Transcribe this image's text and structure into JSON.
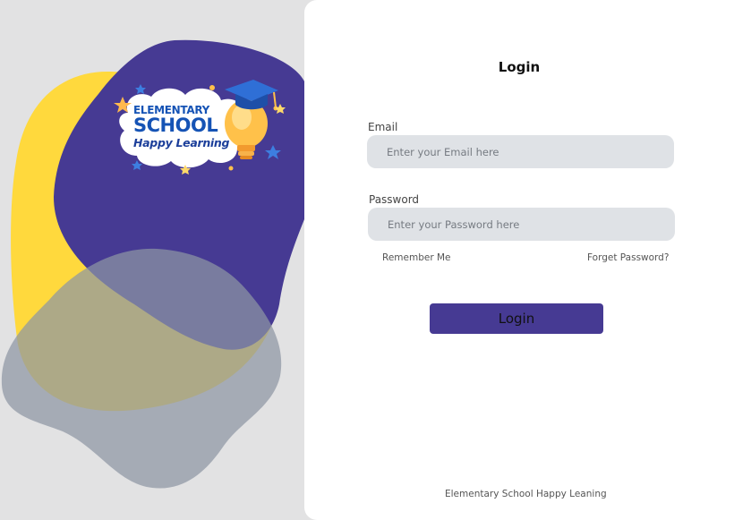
{
  "logo": {
    "line1": "ELEMENTARY",
    "line2": "SCHOOL",
    "line3": "Happy Learning"
  },
  "login": {
    "title": "Login",
    "email_label": "Email",
    "email_placeholder": "Enter your Email here",
    "password_label": "Password",
    "password_placeholder": "Enter your Password here",
    "remember_label": "Remember Me",
    "forgot_label": "Forget Password?",
    "button_label": "Login"
  },
  "footer": {
    "text": "Elementary School Happy Leaning"
  },
  "colors": {
    "background": "#e2e2e3",
    "card": "#ffffff",
    "accent": "#463a93",
    "yellow_blob": "#ffd93d",
    "purple_blob": "#463a93",
    "grey_blob": "#8d95a3",
    "input_bg": "#dfe2e6"
  },
  "icons": [
    "graduation-cap-icon",
    "lightbulb-icon",
    "star-icon"
  ]
}
